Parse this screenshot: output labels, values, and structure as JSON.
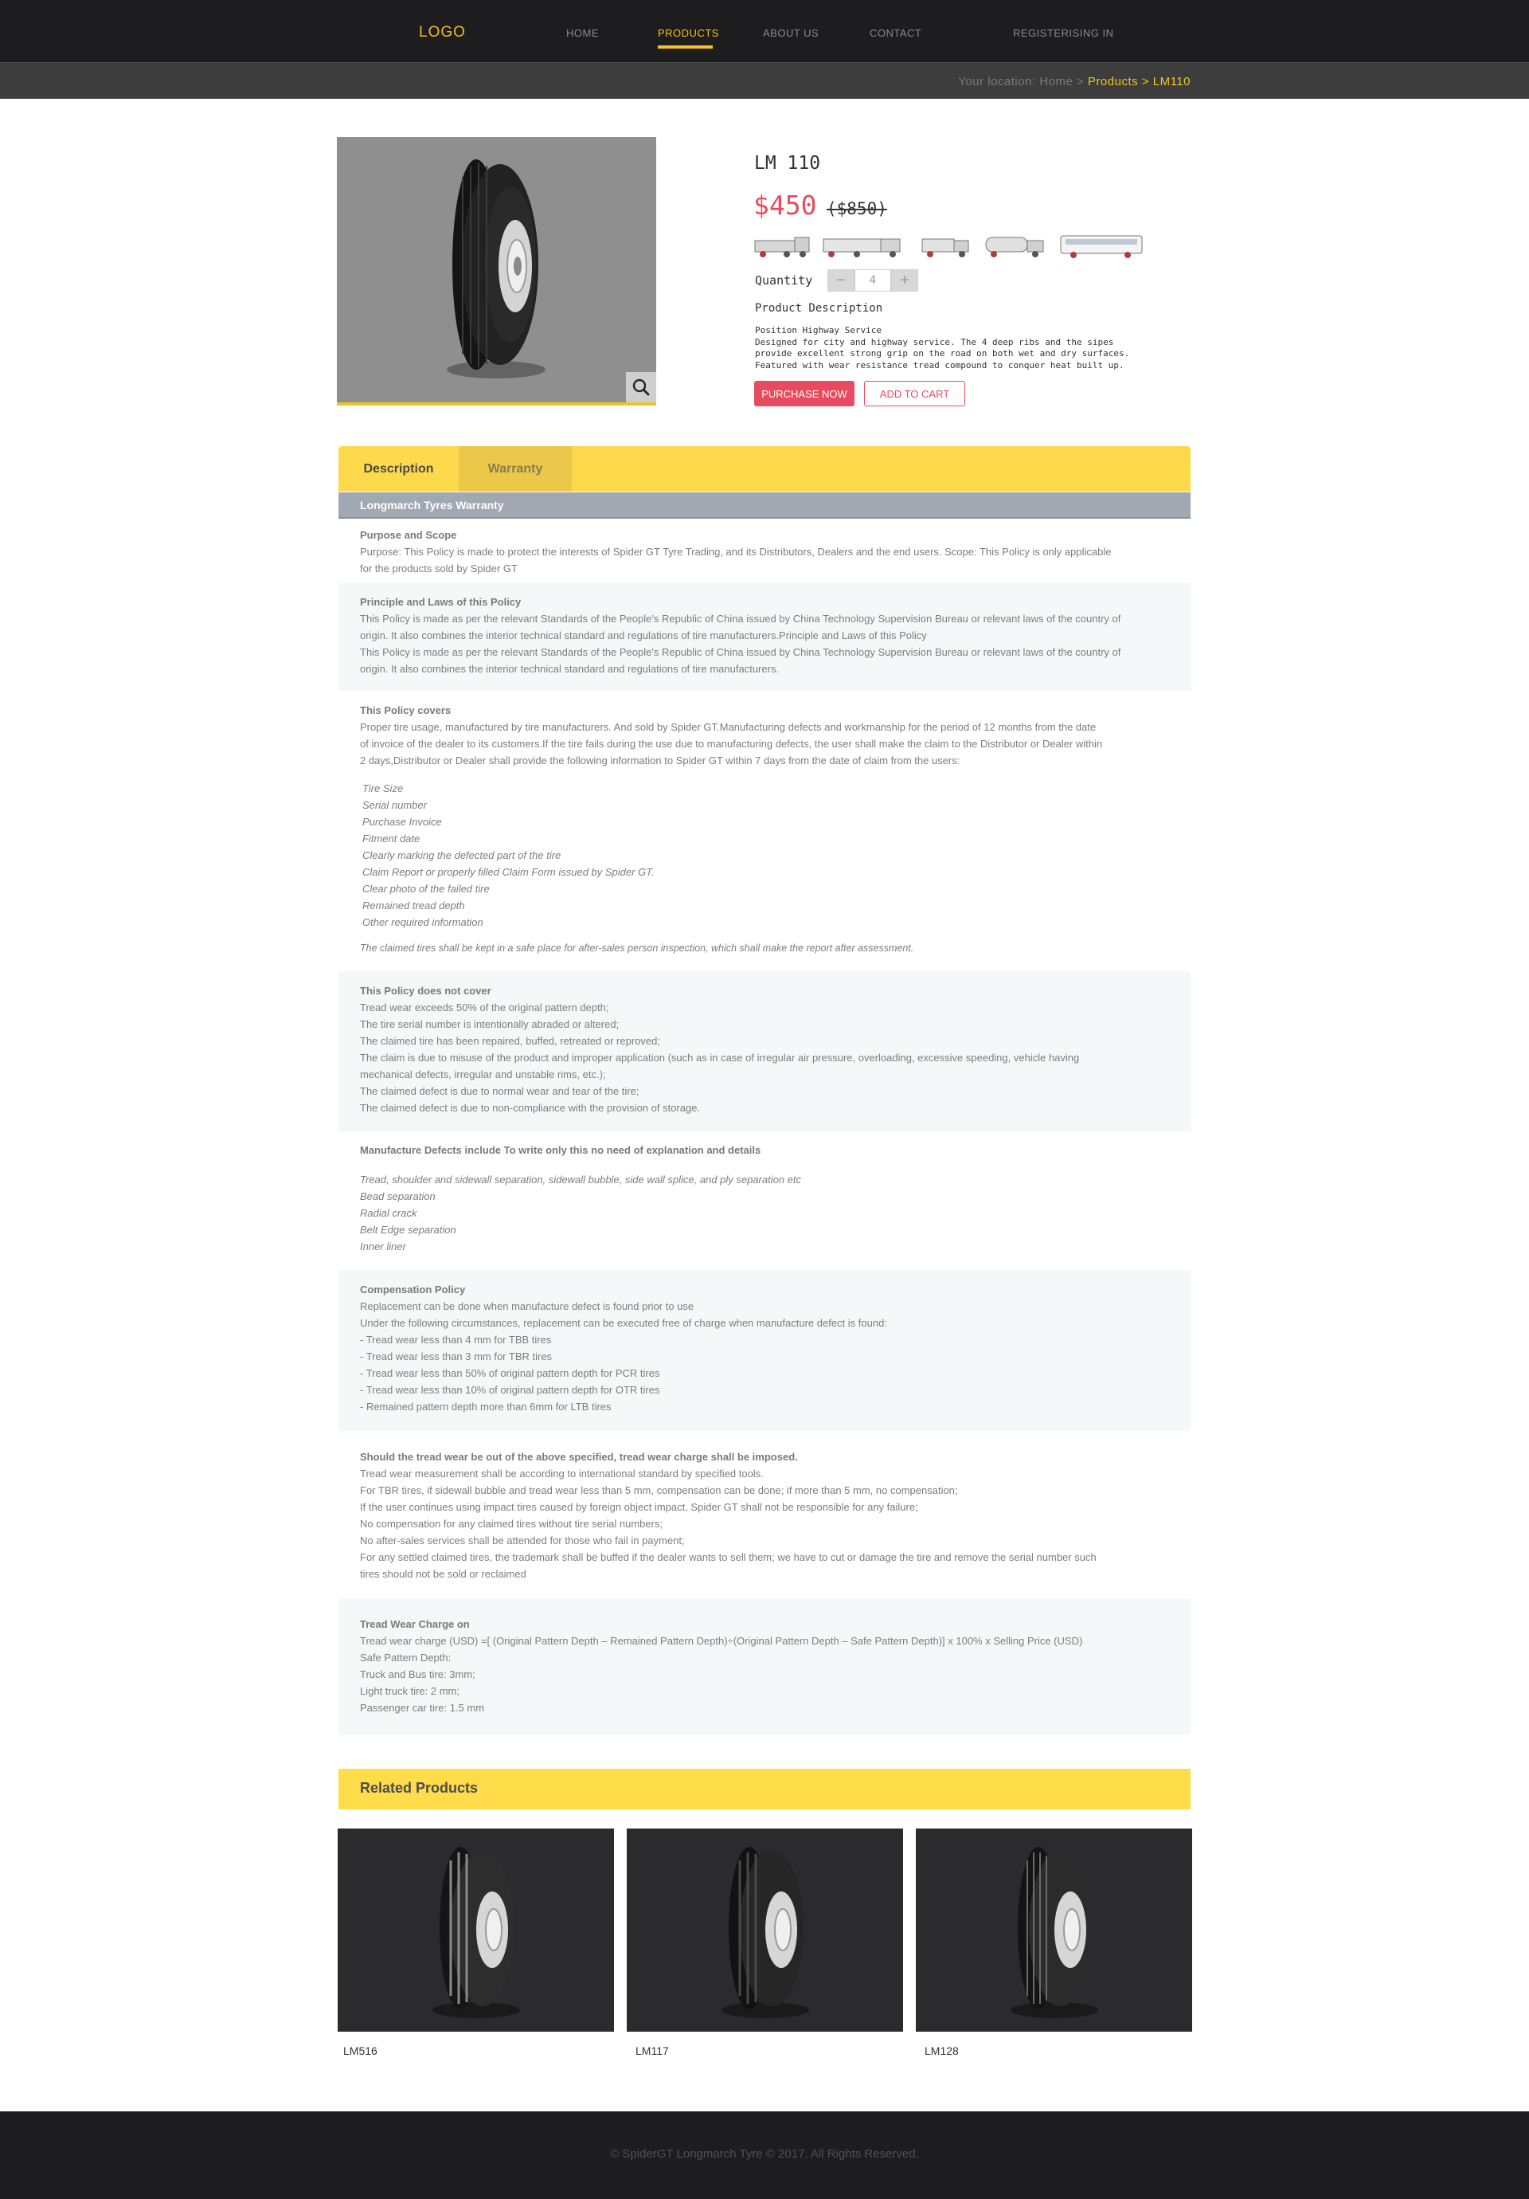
{
  "header": {
    "logo": "LOGO",
    "nav": [
      "HOME",
      "PRODUCTS",
      "ABOUT US",
      "CONTACT"
    ],
    "auth": "REGISTERISING IN",
    "active_nav": "PRODUCTS"
  },
  "breadcrumb": {
    "prefix": "Your location:",
    "home": "Home",
    "sep1": ">",
    "category": "Products",
    "sep2": ">",
    "current": "LM110"
  },
  "product": {
    "name": "LM 110",
    "price": "$450",
    "old_price": "($850)",
    "quantity_label": "Quantity",
    "quantity": "4",
    "minus": "−",
    "plus": "+",
    "description_label": "Product Description",
    "description": [
      "Position Highway Service",
      "Designed for city and highway service. The 4 deep ribs and the sipes",
      "provide excellent strong grip on the road on both wet and dry surfaces.",
      "Featured with wear resistance tread compound to conquer heat built up."
    ],
    "buy_button": "PURCHASE NOW",
    "cart_button": "ADD TO CART"
  },
  "tabs": [
    "Description",
    "Warranty"
  ],
  "warranty": {
    "heading": "Longmarch Tyres Warranty",
    "purpose": {
      "title": "Purpose and Scope",
      "lines": [
        "Purpose: This Policy is made to protect the interests of Spider GT Tyre Trading,  and its Distributors, Dealers and the end users.  Scope: This Policy is only applicable",
        "for the products sold by Spider GT"
      ]
    },
    "principle": {
      "title": "Principle and Laws of this Policy",
      "lines": [
        "This Policy is made as per the relevant Standards of the People's Republic of China issued by China Technology Supervision Bureau or relevant laws of the country of",
        "origin. It also combines the interior technical standard and regulations of tire manufacturers.Principle and Laws of this Policy",
        "This Policy is made as per the relevant Standards of the People's Republic of China issued by China Technology Supervision Bureau or relevant laws of the country of",
        "origin. It also combines the interior technical standard and regulations of tire manufacturers."
      ]
    },
    "covers": {
      "title": "This Policy covers",
      "lines": [
        "Proper tire usage, manufactured by tire manufacturers. And sold by Spider GT.Manufacturing defects and workmanship for the period of 12 months from the date",
        "of invoice of the dealer to its customers.If the tire fails during the use due to manufacturing defects, the user shall make the claim to the Distributor or Dealer within",
        "2 days,Distributor or Dealer shall provide the following information to Spider GT within 7 days from the date of claim from the users:"
      ],
      "items": [
        "Tire Size",
        "Serial number",
        "Purchase Invoice",
        "Fitment date",
        "Clearly marking the defected part of the tire",
        "Claim Report or properly filled Claim Form issued by Spider GT.",
        "Clear photo of the failed tire",
        "Remained tread depth",
        "Other required information"
      ],
      "note": "The claimed tires shall be kept in a safe place for after-sales person inspection, which shall make the report after assessment."
    },
    "not_cover": {
      "title": "This Policy does not cover",
      "lines": [
        "Tread wear exceeds 50% of the original pattern depth;",
        "The tire serial number is intentionally abraded or altered;",
        "The claimed tire has been repaired, buffed, retreated or reproved;",
        "The claim is due to misuse of the product and improper application (such as in case of irregular air pressure, overloading, excessive speeding, vehicle having",
        "mechanical defects, irregular and unstable rims, etc.);",
        "The claimed defect is due to normal wear and tear of the tire;",
        "The claimed defect is due to non-compliance with the provision of storage."
      ]
    },
    "defects": {
      "title": "Manufacture Defects include To write only this no need of explanation and details",
      "items": [
        "Tread, shoulder and sidewall separation, sidewall bubble, side wall splice, and ply separation etc",
        "Bead separation",
        "Radial crack",
        "Belt Edge separation",
        "Inner liner"
      ]
    },
    "compensation": {
      "title": "Compensation Policy",
      "lines": [
        "Replacement can be done when manufacture defect is found prior to use",
        "Under the following circumstances, replacement can be executed free of charge when manufacture defect is found:",
        "- Tread wear less than 4 mm for TBB tires",
        "- Tread wear less than 3 mm for TBR tires",
        "- Tread wear less than 50% of original pattern depth for PCR tires",
        "- Tread wear less than 10% of original pattern depth for OTR tires",
        "- Remained pattern depth more than 6mm for LTB tires"
      ]
    },
    "tread_charge_imposed": {
      "title": "Should the tread wear be out of the above specified, tread wear charge shall be imposed.",
      "lines": [
        "Tread wear measurement shall be according to international standard by specified tools.",
        "For TBR tires, if sidewall bubble and tread wear less than 5 mm, compensation can be done; if more than 5 mm, no compensation;",
        "If the user continues using impact tires caused by foreign object impact, Spider GT shall not be responsible for any failure;",
        "No compensation for any claimed tires without tire serial numbers;",
        "No after-sales services shall be attended for those who fail in payment;",
        "For any settled claimed tires, the trademark shall be buffed if the dealer wants to sell them; we have to cut or damage the tire and remove the serial number such",
        "tires should not be sold or reclaimed"
      ]
    },
    "tread_charge_on": {
      "title": "Tread Wear Charge on",
      "lines": [
        "Tread wear charge (USD) =[ (Original Pattern Depth – Remained Pattern Depth)÷(Original Pattern Depth – Safe Pattern Depth)] x 100% x Selling Price (USD)",
        "Safe Pattern Depth:",
        "Truck and Bus tire: 3mm;",
        "Light truck tire: 2 mm;",
        "Passenger car tire: 1.5 mm"
      ]
    }
  },
  "related": {
    "heading": "Related Products",
    "items": [
      "LM516",
      "LM117",
      "LM128"
    ]
  },
  "footer": {
    "copyright": "© SpiderGT Longmarch Tyre © 2017. All Rights Reserved."
  },
  "colors": {
    "accent_yellow": "#fed94b",
    "price_red": "#e84b5f",
    "header_bg": "#1d1c1e"
  }
}
